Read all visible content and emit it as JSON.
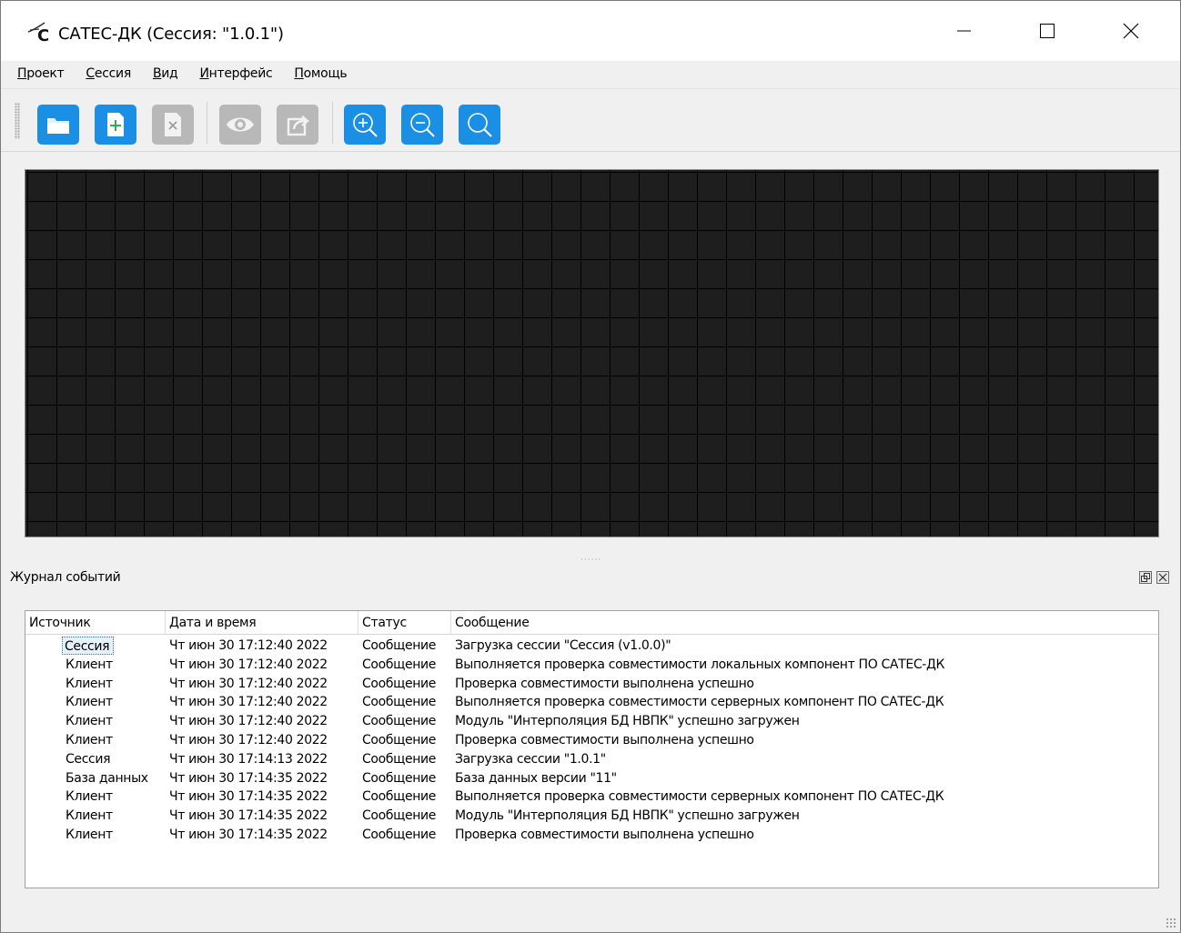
{
  "window": {
    "title": "САТЕС-ДК (Сессия: \"1.0.1\")"
  },
  "menu": {
    "items": [
      {
        "label": "Проект"
      },
      {
        "label": "Сессия"
      },
      {
        "label": "Вид"
      },
      {
        "label": "Интерфейс"
      },
      {
        "label": "Помощь"
      }
    ]
  },
  "toolbar": {
    "buttons": [
      {
        "icon": "folder-open-icon",
        "enabled": true
      },
      {
        "icon": "new-document-icon",
        "enabled": true
      },
      {
        "icon": "close-document-icon",
        "enabled": false
      },
      {
        "icon": "eye-icon",
        "enabled": false
      },
      {
        "icon": "export-icon",
        "enabled": false
      },
      {
        "icon": "zoom-in-icon",
        "enabled": true
      },
      {
        "icon": "zoom-out-icon",
        "enabled": true
      },
      {
        "icon": "zoom-fit-icon",
        "enabled": true
      }
    ],
    "accent_color": "#1a8fe3",
    "disabled_color": "#b8b8b8"
  },
  "event_log": {
    "title": "Журнал событий",
    "columns": [
      "Источник",
      "Дата и время",
      "Статус",
      "Сообщение"
    ],
    "rows": [
      {
        "source": "Сессия",
        "datetime": "Чт июн 30 17:12:40 2022",
        "status": "Сообщение",
        "message": "Загрузка сессии \"Сессия (v1.0.0)\"",
        "selected": true
      },
      {
        "source": "Клиент",
        "datetime": "Чт июн 30 17:12:40 2022",
        "status": "Сообщение",
        "message": "Выполняется проверка совместимости локальных компонент ПО САТЕС-ДК"
      },
      {
        "source": "Клиент",
        "datetime": "Чт июн 30 17:12:40 2022",
        "status": "Сообщение",
        "message": "Проверка совместимости выполнена успешно"
      },
      {
        "source": "Клиент",
        "datetime": "Чт июн 30 17:12:40 2022",
        "status": "Сообщение",
        "message": "Выполняется проверка совместимости серверных компонент ПО САТЕС-ДК"
      },
      {
        "source": "Клиент",
        "datetime": "Чт июн 30 17:12:40 2022",
        "status": "Сообщение",
        "message": "Модуль \"Интерполяция БД НВПК\" успешно загружен"
      },
      {
        "source": "Клиент",
        "datetime": "Чт июн 30 17:12:40 2022",
        "status": "Сообщение",
        "message": "Проверка совместимости выполнена успешно"
      },
      {
        "source": "Сессия",
        "datetime": "Чт июн 30 17:14:13 2022",
        "status": "Сообщение",
        "message": "Загрузка сессии \"1.0.1\""
      },
      {
        "source": "База данных",
        "datetime": "Чт июн 30 17:14:35 2022",
        "status": "Сообщение",
        "message": "База данных версии \"11\""
      },
      {
        "source": "Клиент",
        "datetime": "Чт июн 30 17:14:35 2022",
        "status": "Сообщение",
        "message": "Выполняется проверка совместимости серверных компонент ПО САТЕС-ДК"
      },
      {
        "source": "Клиент",
        "datetime": "Чт июн 30 17:14:35 2022",
        "status": "Сообщение",
        "message": "Модуль \"Интерполяция БД НВПК\" успешно загружен"
      },
      {
        "source": "Клиент",
        "datetime": "Чт июн 30 17:14:35 2022",
        "status": "Сообщение",
        "message": "Проверка совместимости выполнена успешно"
      }
    ]
  }
}
